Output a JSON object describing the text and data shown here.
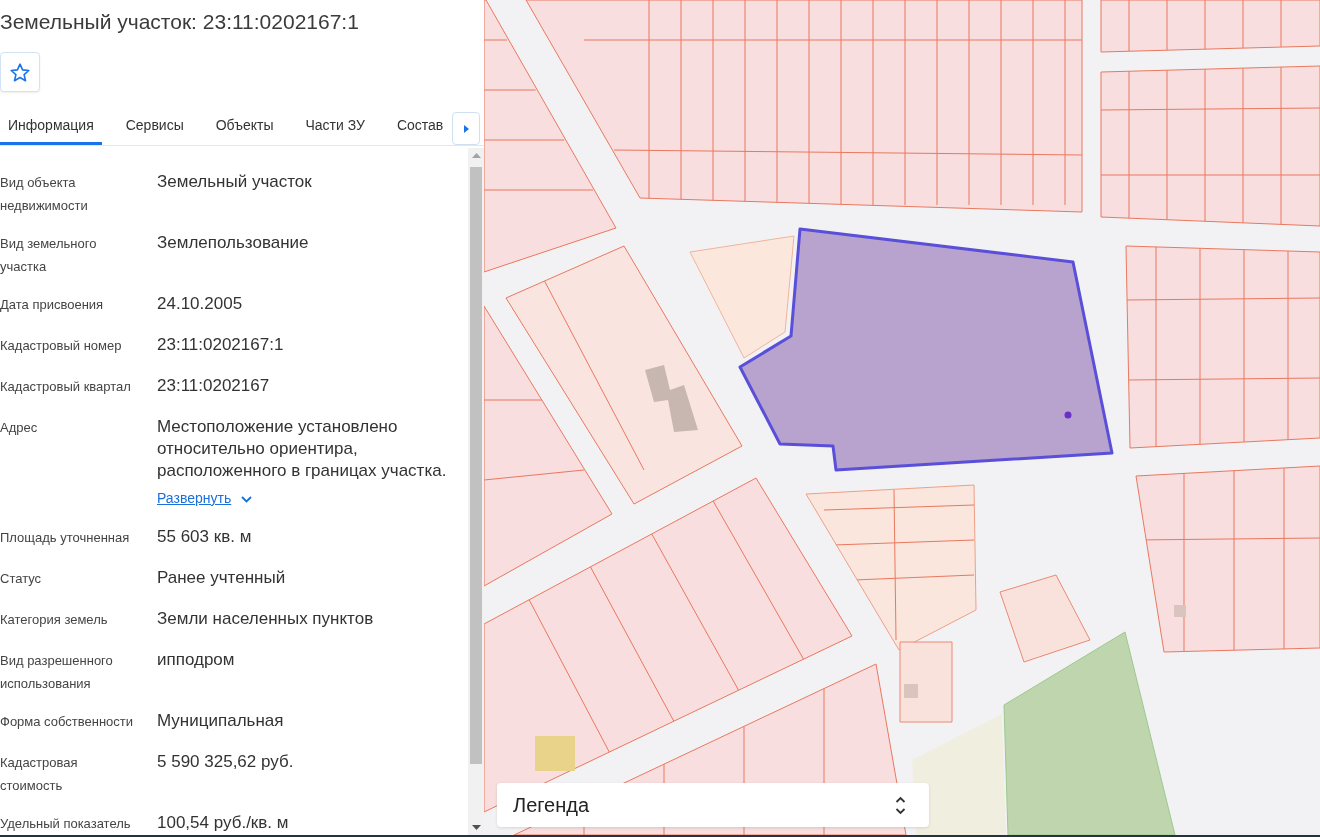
{
  "title": "Земельный участок: 23:11:0202167:1",
  "tabs": [
    {
      "label": "Информация",
      "selected": true
    },
    {
      "label": "Сервисы",
      "selected": false
    },
    {
      "label": "Объекты",
      "selected": false
    },
    {
      "label": "Части ЗУ",
      "selected": false
    },
    {
      "label": "Состав",
      "selected": false
    }
  ],
  "fields": [
    {
      "label": "Вид объекта недвижимости",
      "value": "Земельный участок"
    },
    {
      "label": "Вид земельного участка",
      "value": "Землепользование"
    },
    {
      "label": "Дата присвоения",
      "value": "24.10.2005"
    },
    {
      "label": "Кадастровый номер",
      "value": "23:11:0202167:1"
    },
    {
      "label": "Кадастровый квартал",
      "value": "23:11:0202167"
    },
    {
      "label": "Адрес",
      "value": "Местоположение установлено относительно ориентира, расположенного в границах участка.",
      "link": "Развернуть"
    },
    {
      "label": "Площадь уточненная",
      "value": "55 603 кв. м"
    },
    {
      "label": "Статус",
      "value": "Ранее учтенный"
    },
    {
      "label": "Категория земель",
      "value": "Земли населенных пунктов"
    },
    {
      "label": "Вид разрешенного использования",
      "value": "ипподром"
    },
    {
      "label": "Форма собственности",
      "value": "Муниципальная"
    },
    {
      "label": "Кадастровая стоимость",
      "value": "5 590 325,62 руб."
    },
    {
      "label": "Удельный показатель",
      "value": "100,54 руб./кв. м"
    }
  ],
  "legend": {
    "title": "Легенда"
  }
}
